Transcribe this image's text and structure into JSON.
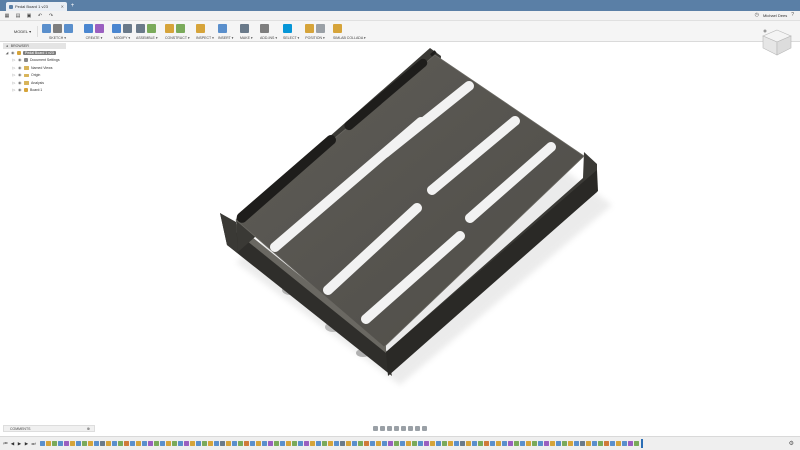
{
  "window": {
    "doc_tab_label": "Pedal Board 1 v23",
    "new_tab_icon": "plus-icon",
    "user_name": "Michael Dees"
  },
  "ribbon": {
    "workspace": "MODEL ▾",
    "groups": [
      {
        "label": "SKETCH ▾",
        "icons": [
          "#5a8fcc",
          "#7e7e7e",
          "#5a8fcc"
        ]
      },
      {
        "label": "CREATE ▾",
        "icons": [
          "#4a86d0",
          "#9a5fc0"
        ]
      },
      {
        "label": "MODIFY ▾",
        "icons": [
          "#4a86d0",
          "#6a7a8a"
        ]
      },
      {
        "label": "ASSEMBLE ▾",
        "icons": [
          "#6a7a8a",
          "#7aaa5a"
        ]
      },
      {
        "label": "CONSTRUCT ▾",
        "icons": [
          "#d6a43a",
          "#7aaa5a"
        ]
      },
      {
        "label": "INSPECT ▾",
        "icons": [
          "#d6a43a"
        ]
      },
      {
        "label": "INSERT ▾",
        "icons": [
          "#5a8fcc"
        ]
      },
      {
        "label": "MAKE ▾",
        "icons": [
          "#6a7a8a"
        ]
      },
      {
        "label": "ADD-INS ▾",
        "icons": [
          "#7e7e7e"
        ]
      },
      {
        "label": "SELECT ▾",
        "icons": [
          "#0696d7"
        ]
      },
      {
        "label": "POSITION ▾",
        "icons": [
          "#d6a43a",
          "#9aa0a6"
        ]
      },
      {
        "label": "SIMLAB COLLADA ▾",
        "icons": [
          "#d6a43a"
        ]
      }
    ]
  },
  "browser": {
    "title": "BROWSER",
    "items": [
      {
        "label": "Pedal Board 1 v23",
        "indent": 0,
        "icon": "lightbulb-icon"
      },
      {
        "label": "Document Settings",
        "indent": 1,
        "icon": "gear-icon"
      },
      {
        "label": "Named Views",
        "indent": 1,
        "icon": "folder-icon"
      },
      {
        "label": "Origin",
        "indent": 1,
        "icon": "folder-icon"
      },
      {
        "label": "Analysis",
        "indent": 1,
        "icon": "folder-icon"
      },
      {
        "label": "Board:1",
        "indent": 1,
        "icon": "component-icon"
      }
    ]
  },
  "comments": {
    "label": "COMMENTS"
  },
  "colors": {
    "titlebar": "#5a7fa6",
    "accent": "#0696d7",
    "model_dark": "#4a4844",
    "model_mid": "#5c5a55"
  },
  "timeline": {
    "feature_colors": [
      "#5a8fcc",
      "#d6a43a",
      "#7aaa5a",
      "#5a8fcc",
      "#9a5fc0",
      "#d6a43a",
      "#5a8fcc",
      "#7aaa5a",
      "#d6a43a",
      "#5a8fcc",
      "#6a7a8a",
      "#d6a43a",
      "#5a8fcc",
      "#7aaa5a",
      "#d07a3a",
      "#5a8fcc",
      "#d6a43a",
      "#5a8fcc",
      "#9a5fc0",
      "#7aaa5a"
    ]
  }
}
